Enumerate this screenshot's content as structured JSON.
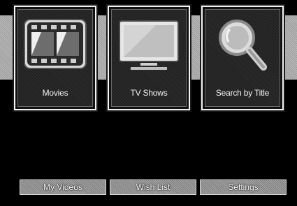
{
  "main_menu": {
    "tiles": [
      {
        "label": "Movies",
        "icon": "film-reel-icon"
      },
      {
        "label": "TV Shows",
        "icon": "television-icon"
      },
      {
        "label": "Search by Title",
        "icon": "magnifying-glass-icon"
      }
    ]
  },
  "bottom_bar": {
    "buttons": [
      {
        "label": "My Videos"
      },
      {
        "label": "Wish List"
      },
      {
        "label": "Settings"
      }
    ]
  }
}
